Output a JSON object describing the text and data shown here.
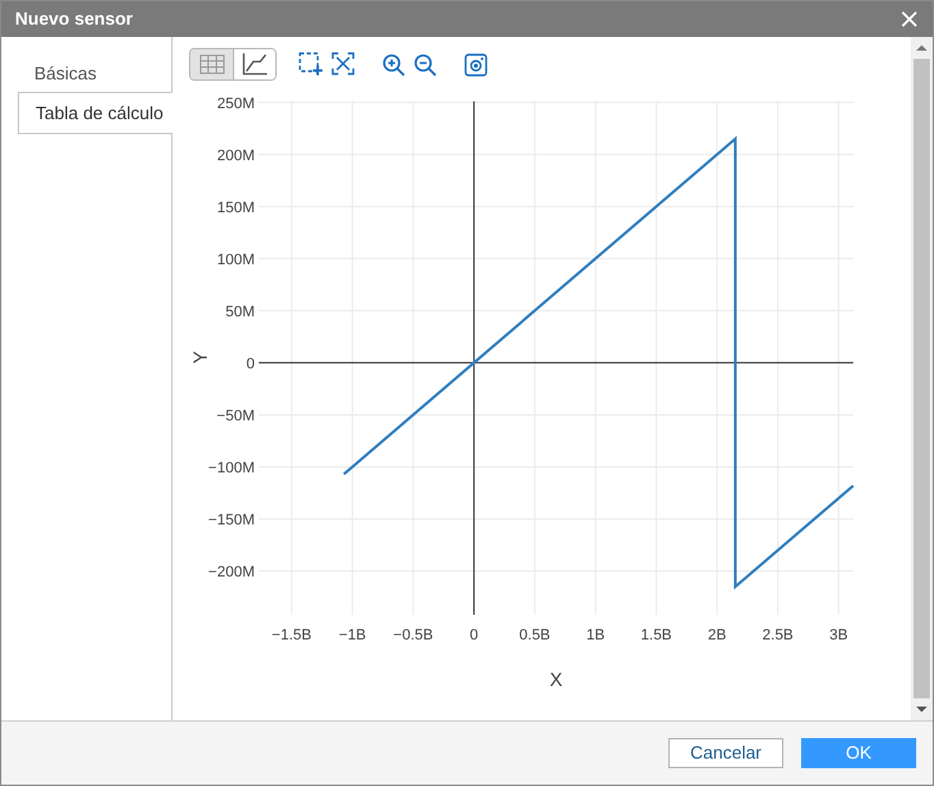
{
  "window": {
    "title": "Nuevo sensor"
  },
  "tabs": [
    {
      "label": "Básicas",
      "selected": false
    },
    {
      "label": "Tabla de cálculo",
      "selected": true
    }
  ],
  "toolbar": {
    "view_buttons": [
      {
        "kind": "table",
        "selected": true
      },
      {
        "kind": "chart",
        "selected": false
      }
    ]
  },
  "chart_data": {
    "type": "line",
    "xlabel": "X",
    "ylabel": "Y",
    "x": [
      -1.07,
      2.15,
      2.15,
      3.12
    ],
    "grid": true,
    "series": [
      {
        "color": "#2e7ebf",
        "values": [
          -107,
          215,
          -215,
          -118
        ]
      }
    ],
    "xlim": [
      -1.77,
      3.12
    ],
    "ylim": [
      -242,
      251
    ],
    "xticks": [
      {
        "value": -1.5,
        "label": "−1.5B"
      },
      {
        "value": -1,
        "label": "−1B"
      },
      {
        "value": -0.5,
        "label": "−0.5B"
      },
      {
        "value": 0,
        "label": "0"
      },
      {
        "value": 0.5,
        "label": "0.5B"
      },
      {
        "value": 1,
        "label": "1B"
      },
      {
        "value": 1.5,
        "label": "1.5B"
      },
      {
        "value": 2,
        "label": "2B"
      },
      {
        "value": 2.5,
        "label": "2.5B"
      },
      {
        "value": 3,
        "label": "3B"
      }
    ],
    "yticks": [
      {
        "value": 250,
        "label": "250M"
      },
      {
        "value": 200,
        "label": "200M"
      },
      {
        "value": 150,
        "label": "150M"
      },
      {
        "value": 100,
        "label": "100M"
      },
      {
        "value": 50,
        "label": "50M"
      },
      {
        "value": 0,
        "label": "0"
      },
      {
        "value": -50,
        "label": "−50M"
      },
      {
        "value": -100,
        "label": "−100M"
      },
      {
        "value": -150,
        "label": "−150M"
      },
      {
        "value": -200,
        "label": "−200M"
      }
    ]
  },
  "buttons": [
    {
      "label": "Cancelar",
      "kind": "secondary"
    },
    {
      "label": "OK",
      "kind": "primary"
    }
  ]
}
